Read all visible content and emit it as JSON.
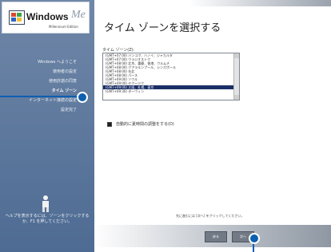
{
  "logo": {
    "brand": "Windows",
    "suffix": "Me",
    "edition": "Millennium Edition"
  },
  "sidebar": {
    "steps": [
      {
        "label": "Windows へようこそ",
        "current": false
      },
      {
        "label": "使用者の設定",
        "current": false
      },
      {
        "label": "使用許諾の同意",
        "current": false
      },
      {
        "label": "タイム ゾーン",
        "current": true
      },
      {
        "label": "インターネット接続の設定",
        "current": false
      },
      {
        "label": "設定完了",
        "current": false
      }
    ],
    "help_text": "ヘルプを表示するには、ゾーンをクリックするか、F1 を押してください。"
  },
  "page": {
    "title": "タイム ゾーンを選択する",
    "list_label": "タイム ゾーン(Z):",
    "timezones": [
      {
        "label": "(GMT+07:00) バンコク、ハノイ、ジャカルタ",
        "selected": false
      },
      {
        "label": "(GMT+07:00) ウラジオストク",
        "selected": false
      },
      {
        "label": "(GMT+08:00) 北京、重慶、香港、ウルムチ",
        "selected": false
      },
      {
        "label": "(GMT+08:00) クアラルンプール、シンガポール",
        "selected": false
      },
      {
        "label": "(GMT+08:00) 台北",
        "selected": false
      },
      {
        "label": "(GMT+08:00) パース",
        "selected": false
      },
      {
        "label": "(GMT+09:00) ソウル",
        "selected": false
      },
      {
        "label": "(GMT+09:00) ヤクーツク",
        "selected": false
      },
      {
        "label": "(GMT+09:00) 大阪、札幌、東京",
        "selected": true
      },
      {
        "label": "(GMT+09:30) ダーウィン",
        "selected": false
      }
    ],
    "dst_label": "自動的に夏時間の調整をする(D)",
    "dst_checked": true,
    "instruction": "先に進むには [次へ] をクリックしてください。"
  },
  "buttons": {
    "back": "戻る",
    "next": "次へ"
  },
  "colors": {
    "sidebar": "#5c7699",
    "selection": "#1a2f66",
    "callout": "#0d5fb0"
  }
}
